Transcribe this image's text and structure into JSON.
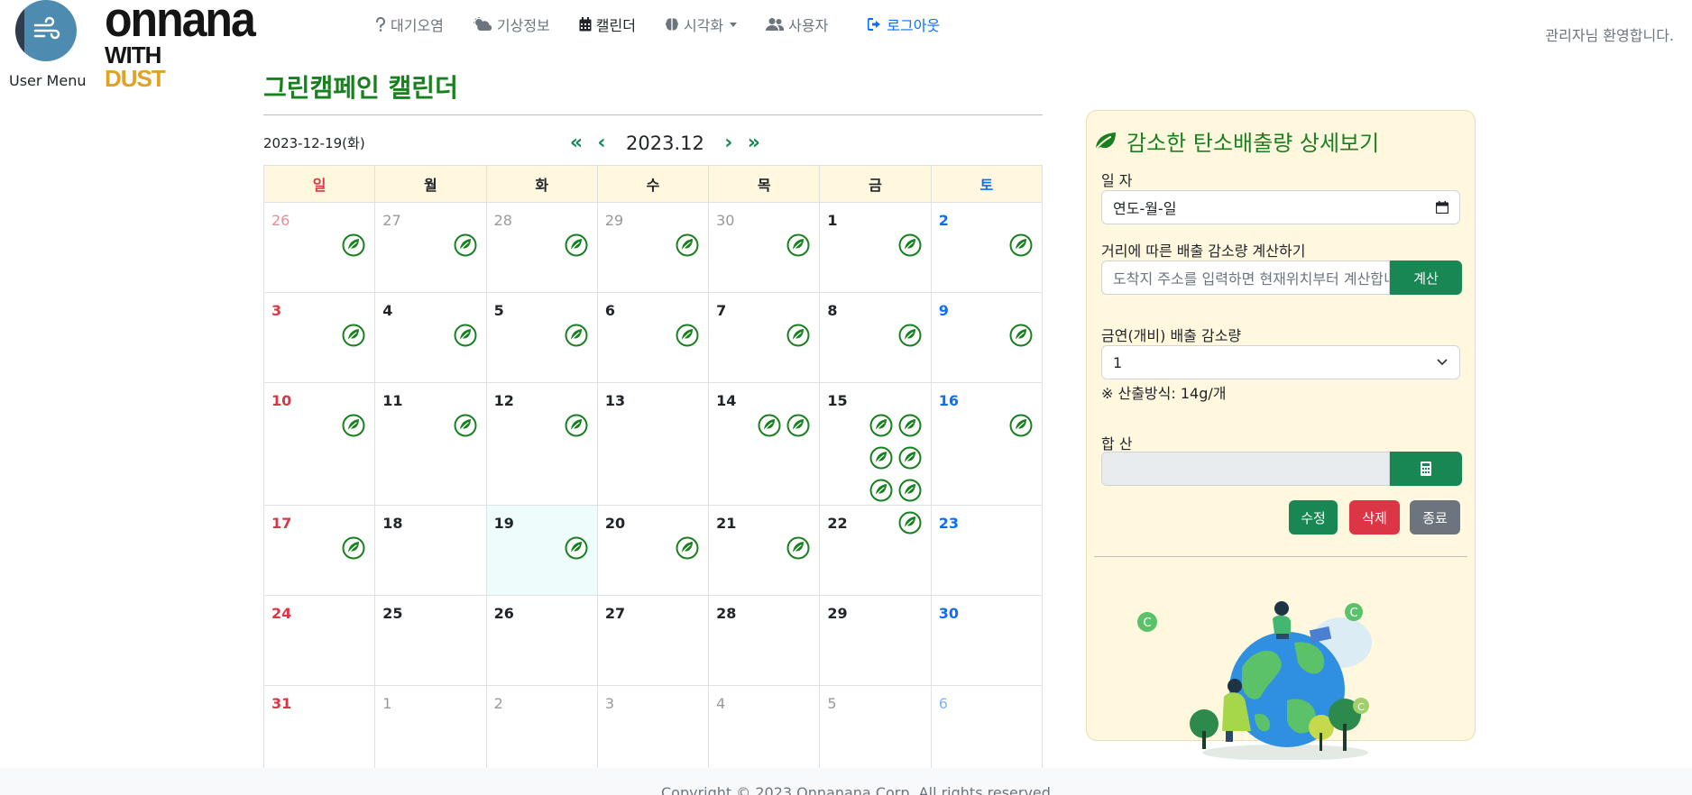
{
  "user_menu": {
    "label": "User Menu"
  },
  "brand": {
    "top": "onnana",
    "with": "WITH",
    "dust": "DUST"
  },
  "nav": {
    "items": [
      {
        "label": "대기오염",
        "icon": "question-icon"
      },
      {
        "label": "기상정보",
        "icon": "cloud-sun-icon"
      },
      {
        "label": "캘린더",
        "icon": "calendar-icon",
        "active": true
      },
      {
        "label": "시각화",
        "icon": "brain-icon",
        "dropdown": true
      },
      {
        "label": "사용자",
        "icon": "users-icon"
      }
    ],
    "logout": "로그아웃"
  },
  "welcome": "관리자님 환영합니다.",
  "page_title": "그린캠페인 캘린더",
  "calendar": {
    "today_label": "2023-12-19(화)",
    "month": "2023.12",
    "weekdays": [
      "일",
      "월",
      "화",
      "수",
      "목",
      "금",
      "토"
    ],
    "weeks": [
      [
        {
          "d": "26",
          "o": 1,
          "l": 1
        },
        {
          "d": "27",
          "o": 1,
          "l": 1
        },
        {
          "d": "28",
          "o": 1,
          "l": 1
        },
        {
          "d": "29",
          "o": 1,
          "l": 1
        },
        {
          "d": "30",
          "o": 1,
          "l": 1
        },
        {
          "d": "1",
          "l": 1
        },
        {
          "d": "2",
          "l": 1
        }
      ],
      [
        {
          "d": "3",
          "l": 1
        },
        {
          "d": "4",
          "l": 1
        },
        {
          "d": "5",
          "l": 1
        },
        {
          "d": "6",
          "l": 1
        },
        {
          "d": "7",
          "l": 1
        },
        {
          "d": "8",
          "l": 1
        },
        {
          "d": "9",
          "l": 1
        }
      ],
      [
        {
          "d": "10",
          "l": 1
        },
        {
          "d": "11",
          "l": 1
        },
        {
          "d": "12",
          "l": 1
        },
        {
          "d": "13",
          "l": 0
        },
        {
          "d": "14",
          "l": 2
        },
        {
          "d": "15",
          "l": 7
        },
        {
          "d": "16",
          "l": 1
        }
      ],
      [
        {
          "d": "17",
          "l": 1
        },
        {
          "d": "18",
          "l": 0
        },
        {
          "d": "19",
          "l": 1,
          "today": 1
        },
        {
          "d": "20",
          "l": 1
        },
        {
          "d": "21",
          "l": 1
        },
        {
          "d": "22",
          "l": 0
        },
        {
          "d": "23",
          "l": 0
        }
      ],
      [
        {
          "d": "24",
          "l": 0
        },
        {
          "d": "25",
          "l": 0
        },
        {
          "d": "26",
          "l": 0
        },
        {
          "d": "27",
          "l": 0
        },
        {
          "d": "28",
          "l": 0
        },
        {
          "d": "29",
          "l": 0
        },
        {
          "d": "30",
          "l": 0
        }
      ],
      [
        {
          "d": "31",
          "l": 0
        },
        {
          "d": "1",
          "o": 1,
          "l": 0
        },
        {
          "d": "2",
          "o": 1,
          "l": 0
        },
        {
          "d": "3",
          "o": 1,
          "l": 0
        },
        {
          "d": "4",
          "o": 1,
          "l": 0
        },
        {
          "d": "5",
          "o": 1,
          "l": 0
        },
        {
          "d": "6",
          "o": 1,
          "l": 0
        }
      ]
    ]
  },
  "panel": {
    "title": "감소한 탄소배출량 상세보기",
    "date_label": "일 자",
    "date_value": "연도-월-일",
    "distance_label": "거리에 따른 배출 감소량 계산하기",
    "distance_placeholder": "도착지 주소를 입력하면 현재위치부터 계산합니다",
    "calc_button": "계산",
    "smoke_label": "금연(개비) 배출 감소량",
    "smoke_value": "1",
    "smoke_note": "※ 산출방식: 14g/개",
    "sum_label": "합 산",
    "sum_value": "",
    "edit_button": "수정",
    "delete_button": "삭제",
    "close_button": "종료"
  },
  "footer": "Copyright © 2023 Onnanana Corp. All rights reserved.",
  "colors": {
    "accent": "#198754",
    "title_green": "#198020",
    "panel_bg": "#fff8df",
    "sunday": "#dc3545",
    "saturday": "#0d6efd"
  }
}
